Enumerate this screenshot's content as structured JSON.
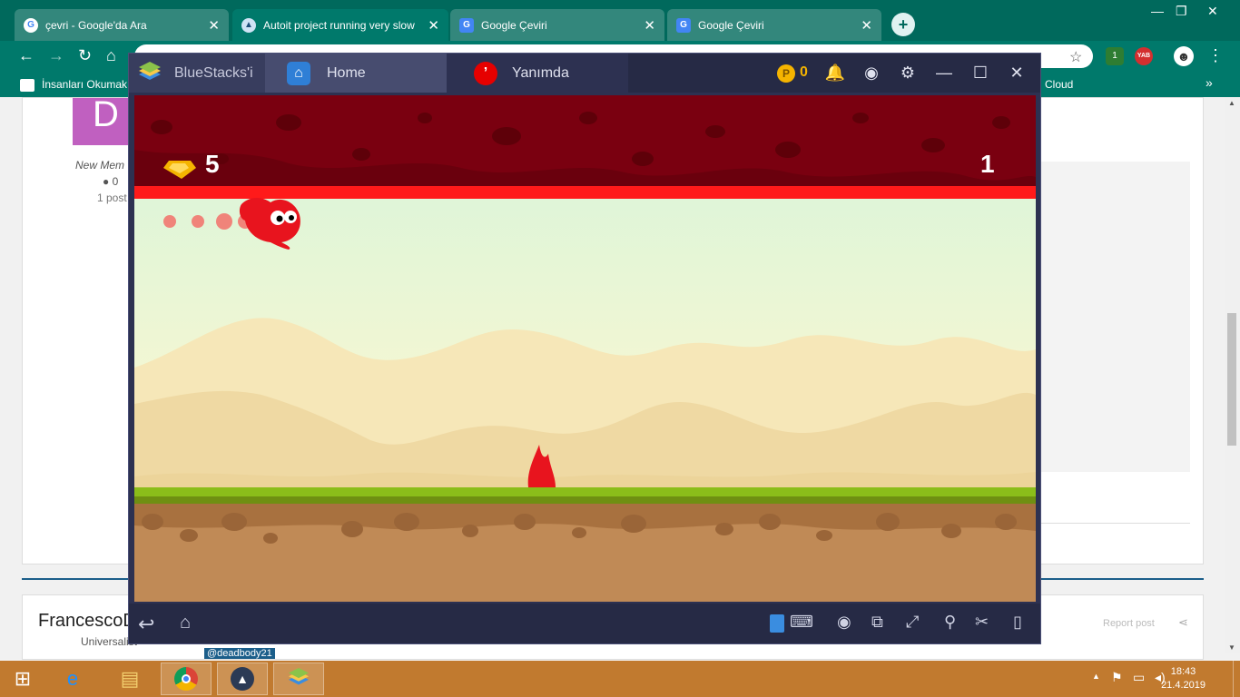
{
  "browser": {
    "tabs": [
      {
        "title": "çevri - Google'da Ara",
        "favicon": "google-icon",
        "active": false
      },
      {
        "title": "Autoit project running very slow",
        "favicon": "autoit-icon",
        "active": true
      },
      {
        "title": "Google Çeviri",
        "favicon": "translate-icon",
        "active": false
      },
      {
        "title": "Google Çeviri",
        "favicon": "translate-icon",
        "active": false
      }
    ],
    "new_tab": "+",
    "extension_badge": "1",
    "extension_yab": "YAB",
    "bookmarks": {
      "first": "İnsanları Okumak",
      "last": "Cloud",
      "overflow": "»"
    }
  },
  "webpage": {
    "member_label": "New Mem",
    "reputation": "0",
    "posts": "1 post",
    "author": "FrancescoD",
    "author_rank": "Universalist",
    "mention": "@deadbody21",
    "report_post": "Report post"
  },
  "bluestacks": {
    "logo_label": "BlueStacks'i",
    "home_tab": "Home",
    "app_tab": "Yanımda",
    "coins": "0",
    "colors": {
      "title_bar": "#262a45",
      "accent": "#e84545"
    }
  },
  "game": {
    "gems": "5",
    "score": "1",
    "colors": {
      "ceiling": "#7a0010",
      "lava_line": "#ff1a1a",
      "sky_top": "#dff5d8",
      "sky_bottom": "#fff8d0",
      "grass": "#8bbd1a",
      "dirt": "#c08a56",
      "player": "#e8141e"
    }
  },
  "taskbar": {
    "time": "18:43",
    "date": "21.4.2019"
  }
}
